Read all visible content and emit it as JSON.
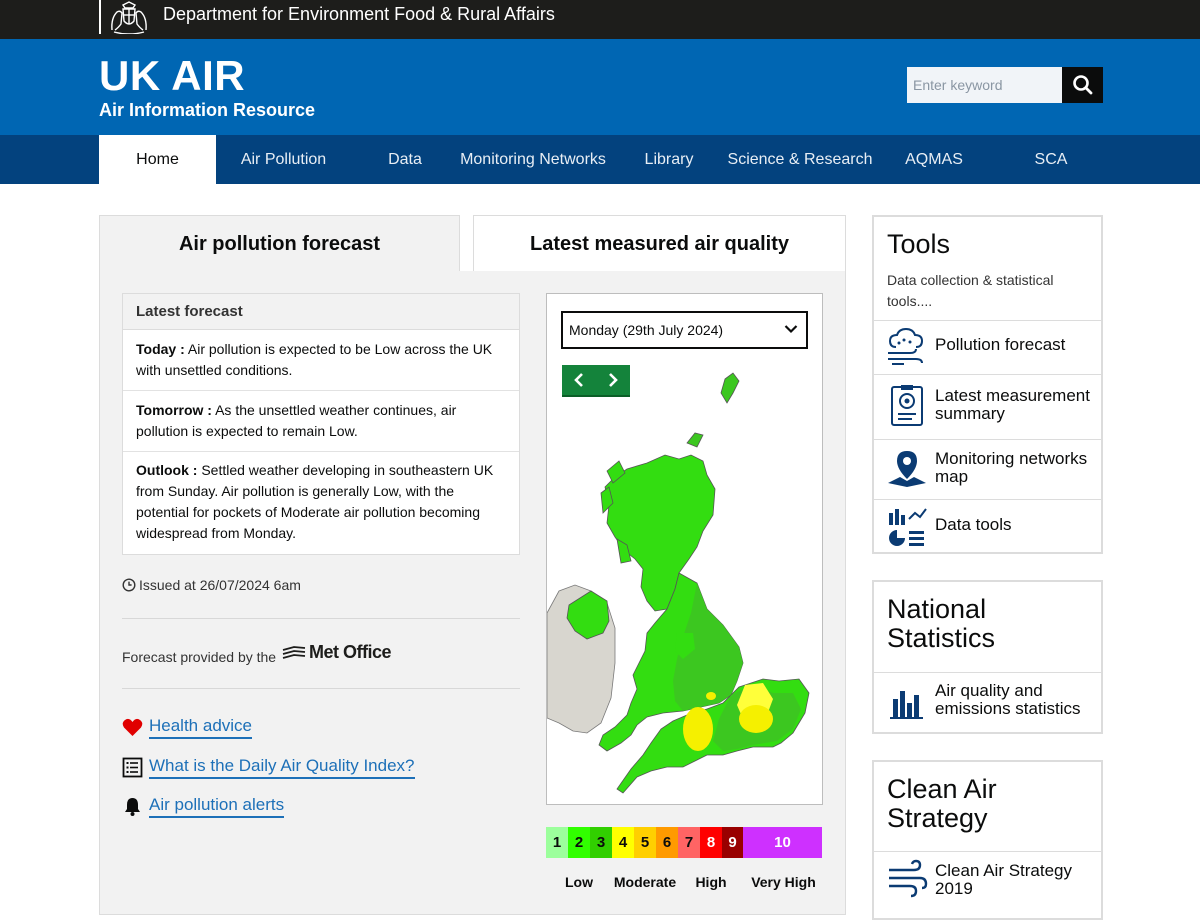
{
  "topbar": {
    "department": "Department for Environment Food & Rural Affairs",
    "crest_icon": "royal-coat-of-arms-icon"
  },
  "header": {
    "title": "UK AIR",
    "subtitle": "Air Information Resource",
    "search_placeholder": "Enter keyword",
    "search_icon": "search-icon"
  },
  "nav": {
    "items": [
      {
        "label": "Home",
        "active": true
      },
      {
        "label": "Air Pollution"
      },
      {
        "label": "Data"
      },
      {
        "label": "Monitoring Networks"
      },
      {
        "label": "Library"
      },
      {
        "label": "Science & Research"
      },
      {
        "label": "AQMAS"
      },
      {
        "label": "SCA"
      }
    ]
  },
  "tabs": [
    {
      "label": "Air pollution forecast",
      "active": true
    },
    {
      "label": "Latest measured air quality"
    }
  ],
  "forecast": {
    "heading": "Latest forecast",
    "items": [
      {
        "term": "Today :",
        "text": " Air pollution is expected to be Low across the UK with unsettled conditions."
      },
      {
        "term": "Tomorrow :",
        "text": " As the unsettled weather continues, air pollution is expected to remain Low."
      },
      {
        "term": "Outlook :",
        "text": " Settled weather developing in southeastern UK from Sunday. Air pollution is generally Low, with the potential for pockets of Moderate air pollution becoming widespread from Monday."
      }
    ],
    "issued": "Issued at 26/07/2024 6am",
    "provided_by": "Forecast provided by the",
    "provider_logo": "Met Office"
  },
  "links": [
    {
      "label": "Health advice",
      "icon": "heart-icon"
    },
    {
      "label": "What is the Daily Air Quality Index?",
      "icon": "document-list-icon"
    },
    {
      "label": "Air pollution alerts",
      "icon": "bell-icon"
    }
  ],
  "map": {
    "selected_day": "Monday (29th July 2024)",
    "prev_icon": "chevron-left-icon",
    "next_icon": "chevron-right-icon"
  },
  "daqi": {
    "levels": [
      {
        "n": "1",
        "color": "#9cff9c"
      },
      {
        "n": "2",
        "color": "#31ff00"
      },
      {
        "n": "3",
        "color": "#31cf00"
      },
      {
        "n": "4",
        "color": "#ffff00"
      },
      {
        "n": "5",
        "color": "#ffcf00"
      },
      {
        "n": "6",
        "color": "#ff9a00"
      },
      {
        "n": "7",
        "color": "#ff6464"
      },
      {
        "n": "8",
        "color": "#ff0000"
      },
      {
        "n": "9",
        "color": "#990000"
      },
      {
        "n": "10",
        "color": "#ce30ff"
      }
    ],
    "bands": [
      "Low",
      "Moderate",
      "High",
      "Very High"
    ]
  },
  "tools": {
    "title": "Tools",
    "subtitle": "Data collection & statistical tools....",
    "items": [
      {
        "label": "Pollution forecast",
        "icon": "cloud-wind-icon"
      },
      {
        "label": "Latest measurement summary",
        "icon": "clipboard-report-icon"
      },
      {
        "label": "Monitoring networks map",
        "icon": "map-pin-icon"
      },
      {
        "label": "Data tools",
        "icon": "charts-icon"
      }
    ]
  },
  "national_statistics": {
    "title": "National Statistics",
    "items": [
      {
        "label": "Air quality and emissions statistics",
        "icon": "bar-chart-icon"
      }
    ]
  },
  "clean_air": {
    "title": "Clean Air Strategy",
    "items": [
      {
        "label": "Clean Air Strategy 2019",
        "icon": "wind-icon"
      }
    ]
  }
}
